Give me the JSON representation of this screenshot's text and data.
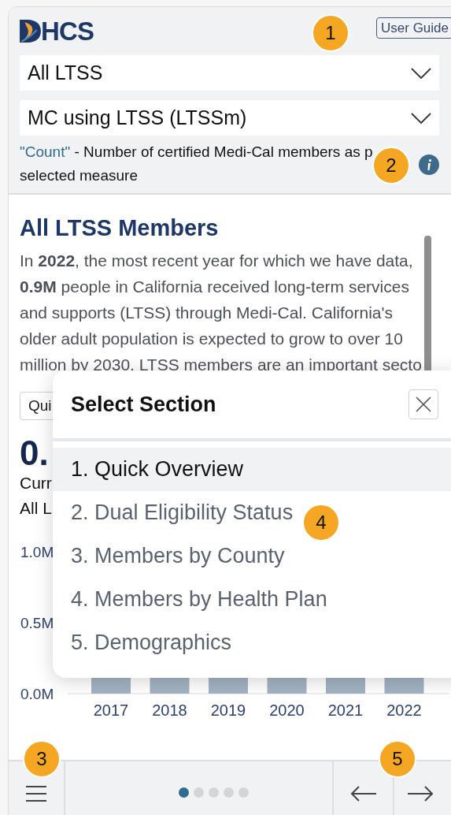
{
  "header": {
    "logo": {
      "text": "HCS"
    },
    "user_guide_button": "User Guide",
    "dropdowns": [
      {
        "value": "All LTSS"
      },
      {
        "value": "MC using LTSS (LTSSm)"
      }
    ],
    "measure_note": {
      "term": "\"Count\"",
      "text": " - Number of certified Medi-Cal members as p selected measure"
    }
  },
  "content": {
    "title": "All LTSS Members",
    "paragraph": "In **2022**, the most recent year for which we have data, **0.9M** people in California received long-term services and supports (LTSS) through Medi-Cal. California's older adult population is expected to grow to over 10 million by 2030. LTSS members are an important secto",
    "section_dropdown": "Qui",
    "big_number": "0.",
    "caption_lines": [
      "Curr",
      "All L"
    ],
    "chart": {
      "y_labels": [
        "1.0M",
        "0.5M",
        "0.0M"
      ],
      "x_labels": [
        "2017",
        "2018",
        "2019",
        "2020",
        "2021",
        "2022"
      ]
    }
  },
  "section_modal": {
    "title": "Select Section",
    "sections": [
      {
        "label": "1. Quick Overview",
        "selected": true
      },
      {
        "label": "2. Dual Eligibility Status",
        "selected": false
      },
      {
        "label": "3. Members by County",
        "selected": false
      },
      {
        "label": "4. Members by Health Plan",
        "selected": false
      },
      {
        "label": "5. Demographics",
        "selected": false
      }
    ]
  },
  "footer": {
    "pages": [
      {
        "selected": true
      },
      {
        "selected": false
      },
      {
        "selected": false
      },
      {
        "selected": false
      },
      {
        "selected": false
      }
    ]
  },
  "callouts": [
    "1",
    "2",
    "3",
    "4",
    "5"
  ]
}
